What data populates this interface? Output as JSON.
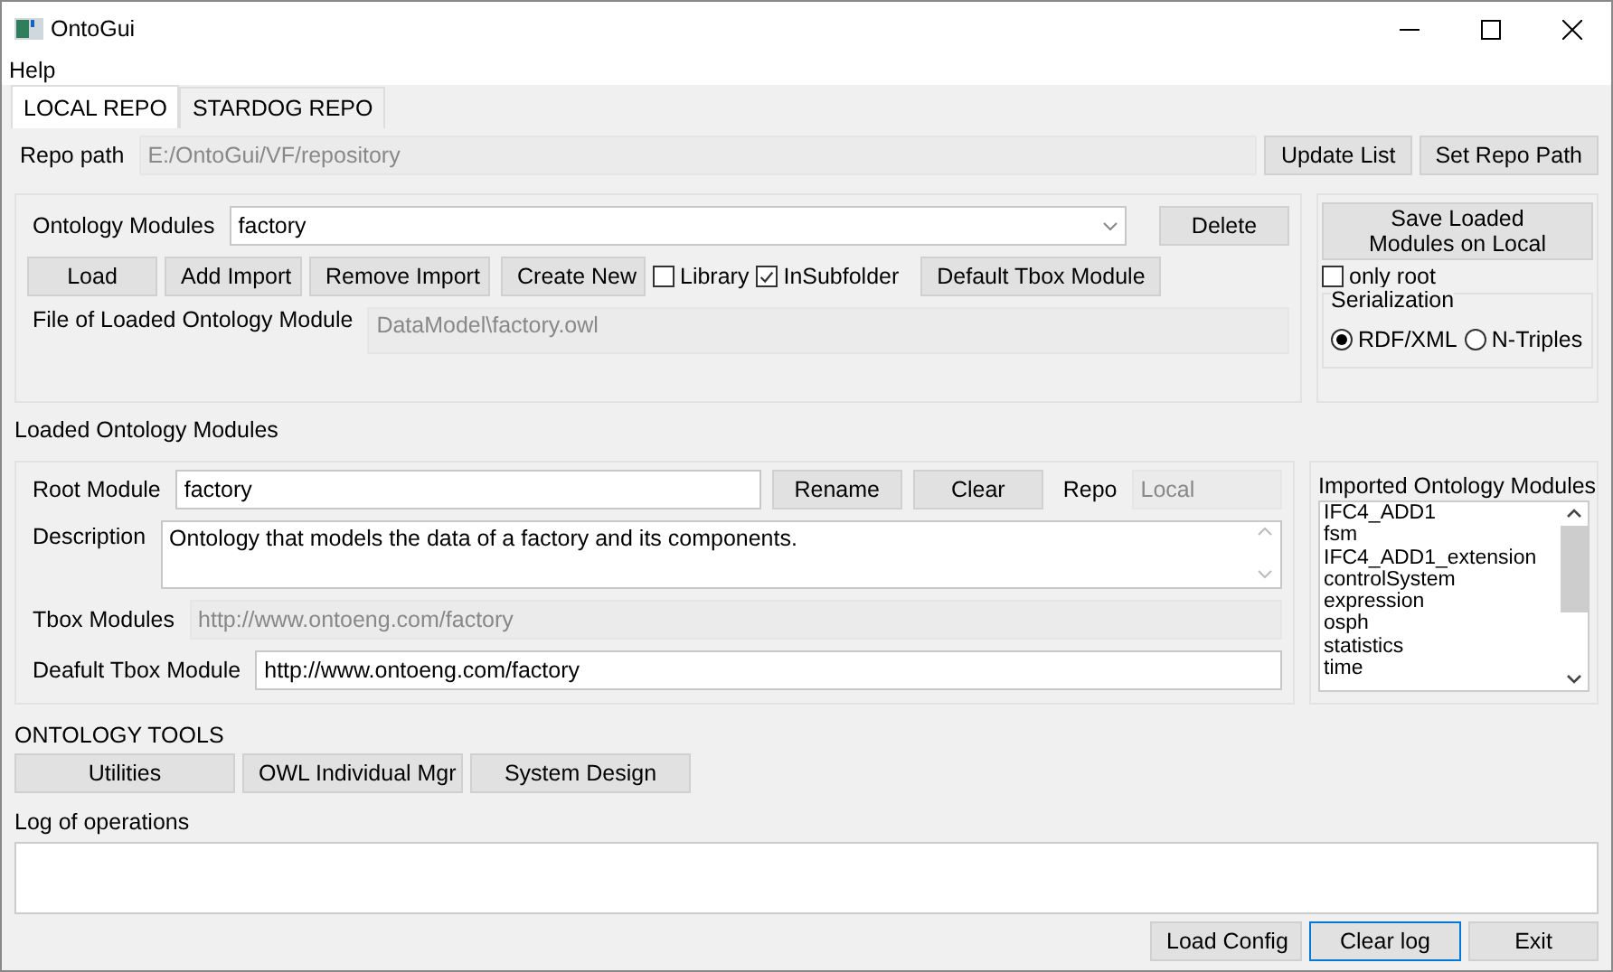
{
  "window": {
    "title": "OntoGui"
  },
  "menu": [
    "Help"
  ],
  "tabs": [
    {
      "label": "LOCAL REPO",
      "selected": true
    },
    {
      "label": "STARDOG REPO",
      "selected": false
    }
  ],
  "repo": {
    "label": "Repo path",
    "value": "E:/OntoGui/VF/repository",
    "buttons": [
      "Update List",
      "Set Repo Path"
    ]
  },
  "modules": {
    "label": "Ontology Modules",
    "value": "factory",
    "delete": "Delete",
    "buttons": [
      "Load",
      "Add Import",
      "Remove Import",
      "Create New"
    ],
    "checks": [
      {
        "label": "Library",
        "checked": false
      },
      {
        "label": "InSubfolder",
        "checked": true
      }
    ],
    "default_button": "Default Tbox Module",
    "file_label": "File of Loaded Ontology Module",
    "file_value": "DataModel\\factory.owl"
  },
  "save": {
    "button": "Save Loaded Modules on Local",
    "only_root": {
      "label": "only root",
      "checked": false
    },
    "serialization": {
      "title": "Serialization",
      "options": [
        {
          "label": "RDF/XML",
          "selected": true
        },
        {
          "label": "N-Triples",
          "selected": false
        }
      ]
    }
  },
  "loaded": {
    "title": "Loaded Ontology Modules",
    "root_label": "Root Module",
    "root_value": "factory",
    "buttons": [
      "Rename",
      "Clear"
    ],
    "repo_label": "Repo",
    "repo_value": "Local",
    "description_label": "Description",
    "description": "Ontology that models the data of a factory and its components.",
    "tbox_label": "Tbox Modules",
    "tbox_value": "http://www.ontoeng.com/factory",
    "default_label": "Deafult Tbox Module",
    "default_value": "http://www.ontoeng.com/factory"
  },
  "imported": {
    "title": "Imported Ontology Modules",
    "items": [
      "IFC4_ADD1",
      "fsm",
      "IFC4_ADD1_extension",
      "controlSystem",
      "expression",
      "osph",
      "statistics",
      "time"
    ]
  },
  "tools": {
    "title": "ONTOLOGY TOOLS",
    "buttons": [
      "Utilities",
      "OWL Individual Mgr",
      "System Design"
    ]
  },
  "log": {
    "title": "Log of operations"
  },
  "bottom_buttons": [
    {
      "label": "Load Config",
      "focused": false
    },
    {
      "label": "Clear log",
      "focused": true
    },
    {
      "label": "Exit",
      "focused": false
    }
  ]
}
